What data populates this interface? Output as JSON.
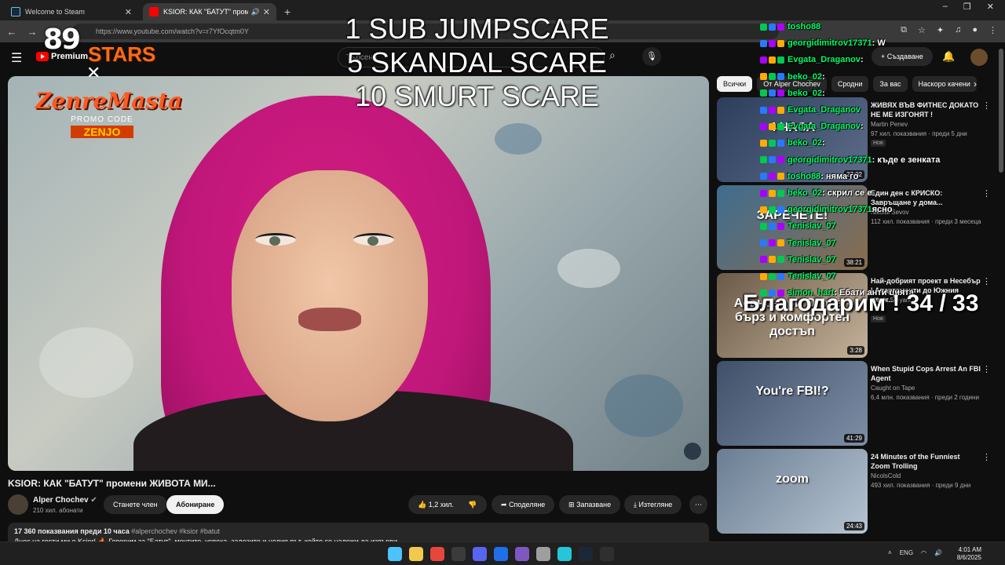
{
  "browser": {
    "tabs": [
      {
        "title": "Welcome to Steam",
        "active": false,
        "favicon_color": "#1b2838"
      },
      {
        "title": "KSIOR: КАК \"БАТУТ\" проме",
        "active": true,
        "favicon_color": "#ff0000"
      }
    ],
    "url": "https://www.youtube.com/watch?v=r7YfOcqtm0Y"
  },
  "youtube": {
    "logo_text": "Premium",
    "search_placeholder": "Търсене",
    "create_label": "+ Създаване"
  },
  "overlays": {
    "logo_num": "89",
    "logo_word": "STARS",
    "logo_x": "✕",
    "promo_brand": "ZenreMasta",
    "promo_label": "PROMO CODE",
    "promo_code": "ZENJO",
    "center_lines": [
      "1 SUB JUMPSCARE",
      "5 SKANDAL SCARE",
      "10 SMURT SCARE"
    ],
    "thanks": "Благодарим ! 34 / 33",
    "chat": [
      {
        "name": "tosho88",
        "msg": "",
        "color": "#00ff66"
      },
      {
        "name": "georgidimitrov17371",
        "msg": " : W",
        "color": "#00ff66"
      },
      {
        "name": "Evgata_Draganov",
        "msg": " :",
        "color": "#00ff66"
      },
      {
        "name": "beko_02",
        "msg": " :",
        "color": "#00ff66"
      },
      {
        "name": "beko_02",
        "msg": " :",
        "color": "#00ff66"
      },
      {
        "name": "Evgata_Draganov",
        "msg": "",
        "color": "#00ff66"
      },
      {
        "name": "Evgata_Draganov",
        "msg": " :",
        "color": "#00ff66"
      },
      {
        "name": "beko_02",
        "msg": " :",
        "color": "#00ff66"
      },
      {
        "name": "georgidimitrov17371",
        "msg": " : къде е зенката",
        "color": "#00ff66"
      },
      {
        "name": "tosho88",
        "msg": " : няма го",
        "color": "#00ff66"
      },
      {
        "name": "beko_02",
        "msg": " : скрил се е",
        "color": "#00ff66"
      },
      {
        "name": "georgidimitrov17371",
        "msg": " ясно",
        "color": "#00ff66"
      },
      {
        "name": "Tenislav_07",
        "msg": "",
        "color": "#00ff66"
      },
      {
        "name": "Tenislav_07",
        "msg": "",
        "color": "#00ff66"
      },
      {
        "name": "Tenislav_07",
        "msg": "",
        "color": "#00ff66"
      },
      {
        "name": "Tenislav_07",
        "msg": "",
        "color": "#00ff66"
      },
      {
        "name": "simon_hart",
        "msg": " : Ебати анти цията",
        "color": "#00ff66"
      }
    ]
  },
  "video": {
    "title": "KSIOR: КАК \"БАТУТ\" промени ЖИВОТА МИ...",
    "channel": "Alper Chochev",
    "subs": "210 хил. абонати",
    "join_label": "Станете член",
    "subscribe_label": "Абониране",
    "likes": "1,2 хил.",
    "share_label": "Споделяне",
    "save_label": "Запазване",
    "download_label": "Изтегляне",
    "views_line": "17 360 показвания  преди 10 часа",
    "tags": "#alperchochev #ksior #batut",
    "desc_line": "Днес на гости ми е Ksior! 🔥 Говорим за \"Батут\", мечтите, успеха, залозите и целия път, който се наложи да извърви..."
  },
  "sidebar": {
    "chips": [
      "Всички",
      "От Alper Chochev",
      "Сродни",
      "За вас",
      "Наскоро качени"
    ],
    "cards": [
      {
        "title": "ЖИВЯХ ВЪВ ФИТНЕС ДОКАТО НЕ МЕ ИЗГОНЯТ !",
        "channel": "Martin Penev",
        "meta": "97 хил. показвания · преди 5 дни",
        "badge": "Нов",
        "duration": "27:02",
        "thumb_text": "4 ЧАСА",
        "c1": "#2d3e5c",
        "c2": "#5d6d8a"
      },
      {
        "title": "Един ден с КРИСКО: Завръщане у дома...",
        "channel": "Nikolai Sevov",
        "meta": "112 хил. показвания · преди 3 месеца",
        "badge": "",
        "duration": "38:21",
        "thumb_text": "ЗАРЕЧЕТЕ!",
        "c1": "#3f6d8f",
        "c2": "#8a6d4f"
      },
      {
        "title": "Най-добрият проект в Несебър | Апартаменти до Южния плаж...",
        "channel": "Nikola Stoyanov",
        "meta": "",
        "badge": "Нов",
        "duration": "3:28",
        "thumb_text": "Асансьори Огона - бърз и комфортен достъп",
        "c1": "#6b5a48",
        "c2": "#c4b29a"
      },
      {
        "title": "When Stupid Cops Arrest An FBI Agent",
        "channel": "Caught on Tape",
        "meta": "6,4 млн. показвания · преди 2 години",
        "badge": "",
        "duration": "41:29",
        "thumb_text": "You're FBI!?",
        "c1": "#40506a",
        "c2": "#7d8ea5"
      },
      {
        "title": "24 Minutes of the Funniest Zoom Trolling",
        "channel": "NicolsCold",
        "meta": "493 хил. показвания · преди 9 дни",
        "badge": "",
        "duration": "24:43",
        "thumb_text": "zoom",
        "c1": "#6a7d92",
        "c2": "#b6c4d2"
      }
    ]
  },
  "taskbar": {
    "lang": "ENG",
    "time": "4:01 AM",
    "date": "8/6/2025",
    "icons": [
      "windows-start",
      "file-explorer",
      "chrome",
      "obs",
      "discord",
      "edge",
      "apps",
      "steam-settings",
      "terminal",
      "steam",
      "epic"
    ]
  },
  "colors": {
    "accent": "#ff0000",
    "bg": "#0f0f0f"
  }
}
